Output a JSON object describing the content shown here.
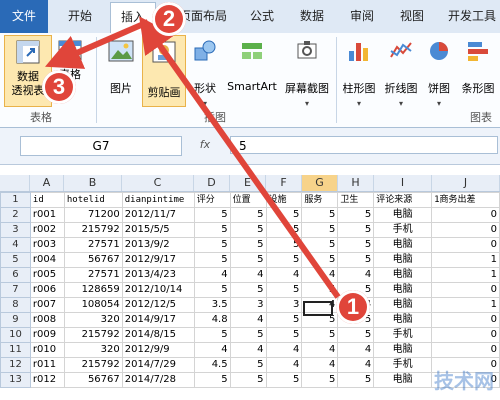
{
  "ribbon_tabs": [
    "文件",
    "开始",
    "插入",
    "页面布局",
    "公式",
    "数据",
    "审阅",
    "视图",
    "开发工具"
  ],
  "ribbon": {
    "pivot_table": "数据\n透视表",
    "table": "表格",
    "picture": "图片",
    "clipart": "剪贴画",
    "shapes": "形状",
    "smartart": "SmartArt",
    "screenshot": "屏幕截图",
    "column_chart": "柱形图",
    "line_chart": "折线图",
    "pie_chart": "饼图",
    "bar_chart": "条形图",
    "groups": {
      "tables": "表格",
      "illustrations": "插图",
      "charts": "图表"
    }
  },
  "formula_bar": {
    "name_box": "G7",
    "fx": "fx",
    "value": "5"
  },
  "columns": [
    "A",
    "B",
    "C",
    "D",
    "E",
    "F",
    "G",
    "H",
    "I",
    "J"
  ],
  "rows": [
    {
      "n": "1",
      "cells": [
        "id",
        "hotelid",
        "dianpintime",
        "评分",
        "位置",
        "设施",
        "服务",
        "卫生",
        "评论来源",
        "1商务出差"
      ]
    },
    {
      "n": "2",
      "cells": [
        "r001",
        "71200",
        "2012/11/7",
        "5",
        "5",
        "5",
        "5",
        "5",
        "电脑",
        "0"
      ]
    },
    {
      "n": "3",
      "cells": [
        "r002",
        "215792",
        "2015/5/5",
        "5",
        "5",
        "5",
        "5",
        "5",
        "手机",
        "0"
      ]
    },
    {
      "n": "4",
      "cells": [
        "r003",
        "27571",
        "2013/9/2",
        "5",
        "5",
        "5",
        "5",
        "5",
        "电脑",
        "0"
      ]
    },
    {
      "n": "5",
      "cells": [
        "r004",
        "56767",
        "2012/9/17",
        "5",
        "5",
        "5",
        "5",
        "5",
        "电脑",
        "1"
      ]
    },
    {
      "n": "6",
      "cells": [
        "r005",
        "27571",
        "2013/4/23",
        "4",
        "4",
        "4",
        "4",
        "4",
        "电脑",
        "1"
      ]
    },
    {
      "n": "7",
      "cells": [
        "r006",
        "128659",
        "2012/10/14",
        "5",
        "5",
        "5",
        "5",
        "5",
        "电脑",
        "0"
      ]
    },
    {
      "n": "8",
      "cells": [
        "r007",
        "108054",
        "2012/12/5",
        "3.5",
        "3",
        "3",
        "4",
        "4",
        "电脑",
        "1"
      ]
    },
    {
      "n": "9",
      "cells": [
        "r008",
        "320",
        "2014/9/17",
        "4.8",
        "4",
        "5",
        "5",
        "5",
        "电脑",
        "0"
      ]
    },
    {
      "n": "10",
      "cells": [
        "r009",
        "215792",
        "2014/8/15",
        "5",
        "5",
        "5",
        "5",
        "5",
        "手机",
        "0"
      ]
    },
    {
      "n": "11",
      "cells": [
        "r010",
        "320",
        "2012/9/9",
        "4",
        "4",
        "4",
        "4",
        "4",
        "电脑",
        "0"
      ]
    },
    {
      "n": "12",
      "cells": [
        "r011",
        "215792",
        "2014/7/29",
        "4.5",
        "5",
        "4",
        "4",
        "4",
        "手机",
        "0"
      ]
    },
    {
      "n": "13",
      "cells": [
        "r012",
        "56767",
        "2014/7/28",
        "5",
        "5",
        "5",
        "5",
        "5",
        "电脑",
        "0"
      ]
    }
  ],
  "annotations": {
    "step1": "1",
    "step2": "2",
    "step3": "3"
  },
  "watermark": "技术网"
}
